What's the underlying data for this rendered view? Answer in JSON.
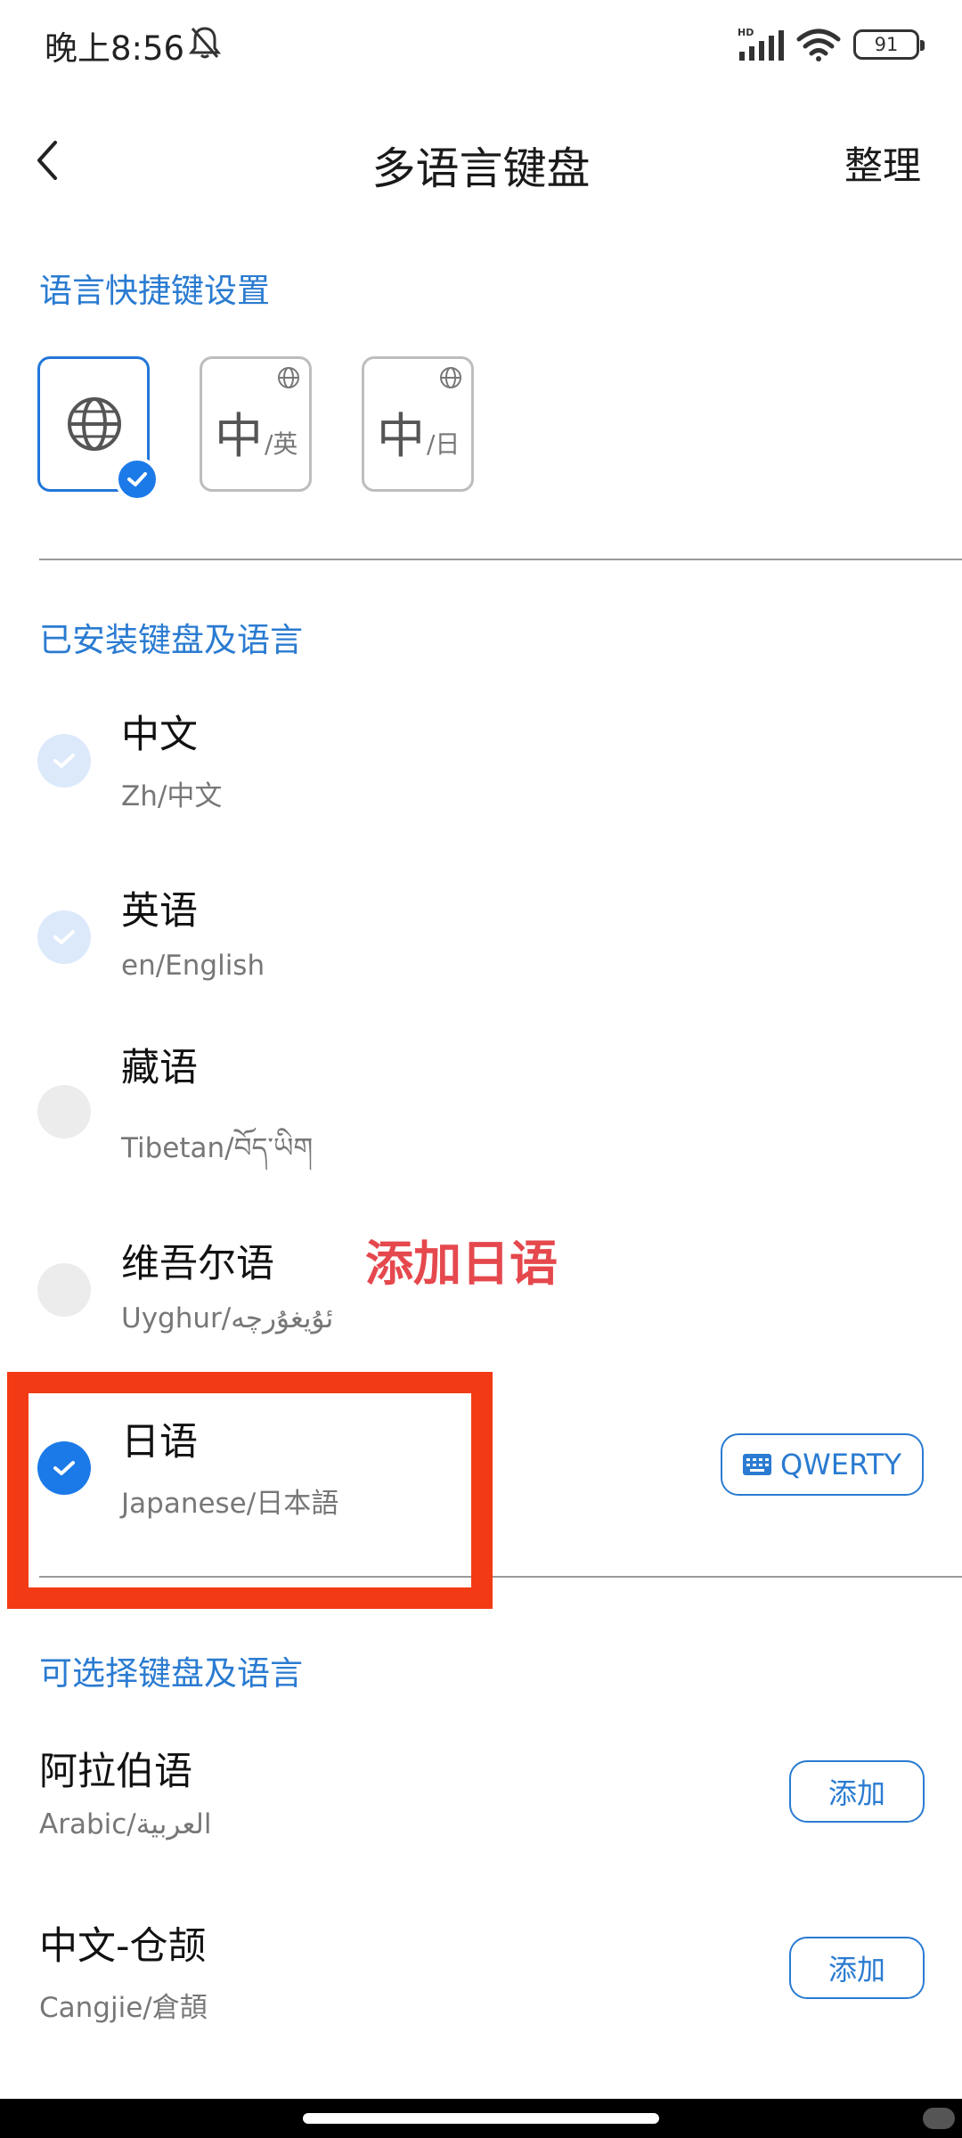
{
  "status_bar": {
    "time": "晚上8:56",
    "network_label": "HD",
    "battery": "91",
    "icons": [
      "bell-off-icon",
      "signal-icon",
      "wifi-icon",
      "battery-icon"
    ]
  },
  "header": {
    "title": "多语言键盘",
    "action": "整理",
    "back_icon": "chevron-left-icon"
  },
  "shortcut_section": {
    "title": "语言快捷键设置",
    "options": [
      {
        "id": "globe",
        "icon": "globe-icon",
        "selected": true
      },
      {
        "big": "中",
        "small": "/英",
        "icon": "globe-icon",
        "selected": false
      },
      {
        "big": "中",
        "small": "/日",
        "icon": "globe-icon",
        "selected": false
      }
    ]
  },
  "installed_section": {
    "title": "已安装键盘及语言",
    "items": [
      {
        "name": "中文",
        "sub": "Zh/中文",
        "state": "checked-disabled"
      },
      {
        "name": "英语",
        "sub": "en/English",
        "state": "checked-disabled"
      },
      {
        "name": "藏语",
        "sub": "Tibetan/བོད་ཡིག",
        "state": "unchecked"
      },
      {
        "name": "维吾尔语",
        "sub": "Uyghur/ئۇيغۇرچە",
        "state": "unchecked"
      },
      {
        "name": "日语",
        "sub": "Japanese/日本語",
        "state": "checked",
        "layout_button": "QWERTY"
      }
    ]
  },
  "annotation": {
    "text": "添加日语",
    "color": "#e5484d",
    "box_color": "#f23a14"
  },
  "available_section": {
    "title": "可选择键盘及语言",
    "items": [
      {
        "name": "阿拉伯语",
        "sub": "Arabic/العربية",
        "button": "添加"
      },
      {
        "name": "中文-仓颉",
        "sub": "Cangjie/倉頡",
        "button": "添加"
      }
    ]
  },
  "colors": {
    "accent": "#2a7bd1",
    "check": "#1c7ae8"
  }
}
